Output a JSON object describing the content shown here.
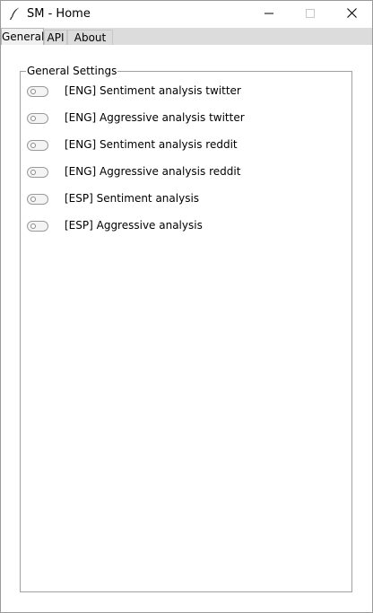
{
  "window": {
    "title": "SM - Home",
    "icon": "feather-icon",
    "controls": [
      "minimize-icon",
      "maximize-icon",
      "close-icon"
    ]
  },
  "tabs": [
    {
      "label": "General",
      "active": true
    },
    {
      "label": "API",
      "active": false
    },
    {
      "label": "About ...",
      "active": false
    }
  ],
  "general": {
    "group_title": "General Settings",
    "settings": [
      {
        "label": "[ENG] Sentiment analysis twitter",
        "enabled": false
      },
      {
        "label": "[ENG] Aggressive analysis twitter",
        "enabled": false
      },
      {
        "label": "[ENG] Sentiment analysis reddit",
        "enabled": false
      },
      {
        "label": "[ENG] Aggressive analysis reddit",
        "enabled": false
      },
      {
        "label": "[ESP] Sentiment analysis",
        "enabled": false
      },
      {
        "label": "[ESP] Aggressive analysis",
        "enabled": false
      }
    ]
  }
}
